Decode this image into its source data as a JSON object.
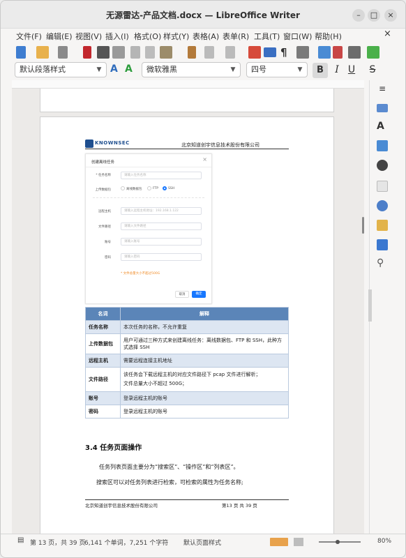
{
  "window": {
    "title": "无源雷达-产品文档.docx — LibreOffice Writer"
  },
  "menu": [
    "文件(F)",
    "编辑(E)",
    "视图(V)",
    "插入(I)",
    "格式(O)",
    "样式(Y)",
    "表格(A)",
    "表单(R)",
    "工具(T)",
    "窗口(W)",
    "帮助(H)"
  ],
  "toolbar": {
    "para_style": "默认段落样式",
    "font": "微软雅黑",
    "size": "四号",
    "bold": "B",
    "italic": "I",
    "underline": "U",
    "strike": "S"
  },
  "doc": {
    "header_company": "北京知道创宇信息技术股份有限公司",
    "logo_text": "KNOWNSEC",
    "dialog": {
      "title": "创建离线任务",
      "close": "×",
      "task_name_label": "* 任务名称",
      "task_name_ph": "请输入任务名称",
      "upload_label": "上传数据包",
      "opt1": "离线数据包",
      "opt2": "FTP",
      "opt3": "SSH",
      "host_label": "远程主机",
      "host_ph": "请输入远程主机地址：192.168.1.122",
      "path_label": "文件路径",
      "path_ph": "请输入文件路径",
      "account_label": "账号",
      "account_ph": "请输入账号",
      "password_label": "密码",
      "password_ph": "请输入密码",
      "note": "* 文件总量大小不超过500G",
      "cancel": "取消",
      "ok": "确定"
    },
    "table": {
      "headers": [
        "名词",
        "解释"
      ],
      "rows": [
        [
          "任务名称",
          "本次任务的名称，不允许重复"
        ],
        [
          "上传数据包",
          "用户可通过三种方式来创建离线任务：离线数据包、FTP 和 SSH，此种方式选择 SSH"
        ],
        [
          "远程主机",
          "需要远程连接主机地址"
        ],
        [
          "文件路径",
          "该任务会下载远程主机的对应文件路径下 pcap 文件进行解析；\n文件总量大小不超过 500G；"
        ],
        [
          "账号",
          "登录远程主机的账号"
        ],
        [
          "密码",
          "登录远程主机的账号"
        ]
      ]
    },
    "heading": "3.4 任务页面操作",
    "para1": "任务列表页面主要分为“搜索区”、“操作区”和“列表区”。",
    "para2": "搜索区可以对任务列表进行检索，可检索的属性为任务名称;",
    "footer_company": "北京知道创宇信息技术股份有限公司",
    "footer_page": "第13 页 共 39 页"
  },
  "status": {
    "page": "第 13 页，共 39 页",
    "words": "6,141 个单词，7,251 个字符",
    "page_style": "默认页面样式",
    "zoom": "80%",
    "zoom_level": 0.8
  },
  "colors": {
    "table_header": "#5b85b8",
    "table_odd": "#dde6f2",
    "primary_btn": "#1677ff",
    "note": "#f08c28"
  }
}
